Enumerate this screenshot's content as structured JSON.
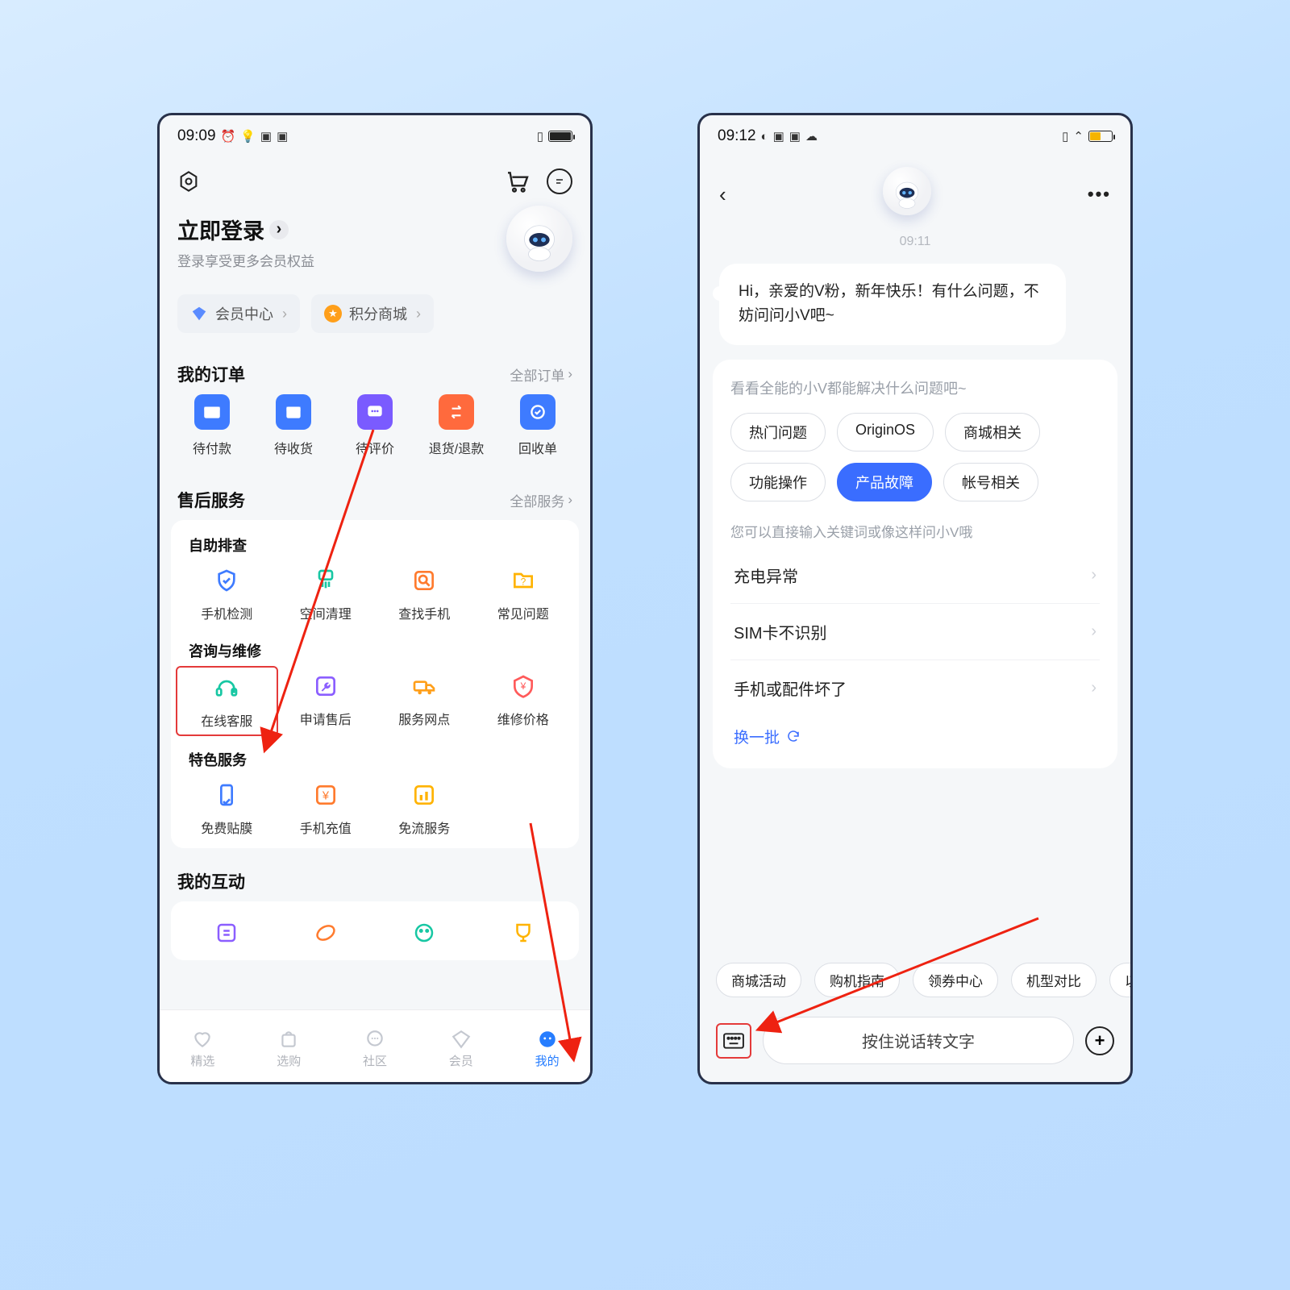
{
  "phone1": {
    "status": {
      "time": "09:09"
    },
    "login": {
      "title": "立即登录",
      "subtitle": "登录享受更多会员权益"
    },
    "chips": [
      {
        "label": "会员中心",
        "icon": "diamond",
        "color": "#5a8bff"
      },
      {
        "label": "积分商城",
        "icon": "star",
        "color": "#ff9f1a"
      }
    ],
    "orders": {
      "title": "我的订单",
      "link": "全部订单",
      "items": [
        {
          "label": "待付款",
          "icon": "wallet",
          "bg": "#3e7bff"
        },
        {
          "label": "待收货",
          "icon": "box",
          "bg": "#3e7bff"
        },
        {
          "label": "待评价",
          "icon": "chat",
          "bg": "#7a5bff"
        },
        {
          "label": "退货/退款",
          "icon": "swap",
          "bg": "#ff6a3d"
        },
        {
          "label": "回收单",
          "icon": "recycle",
          "bg": "#3e7bff"
        }
      ]
    },
    "aftersale": {
      "title": "售后服务",
      "link": "全部服务",
      "groups": [
        {
          "title": "自助排查",
          "items": [
            {
              "label": "手机检测",
              "icon": "shield",
              "color": "#3e7bff"
            },
            {
              "label": "空间清理",
              "icon": "brush",
              "color": "#17c7a3"
            },
            {
              "label": "查找手机",
              "icon": "search",
              "color": "#ff7b2e"
            },
            {
              "label": "常见问题",
              "icon": "folder",
              "color": "#ffb300"
            }
          ]
        },
        {
          "title": "咨询与维修",
          "items": [
            {
              "label": "在线客服",
              "icon": "headset",
              "color": "#17c7a3"
            },
            {
              "label": "申请售后",
              "icon": "wrench",
              "color": "#8b5eff"
            },
            {
              "label": "服务网点",
              "icon": "truck",
              "color": "#ff9f1a"
            },
            {
              "label": "维修价格",
              "icon": "tag",
              "color": "#ff5a5a"
            }
          ]
        },
        {
          "title": "特色服务",
          "items": [
            {
              "label": "免费贴膜",
              "icon": "phone",
              "color": "#3e7bff"
            },
            {
              "label": "手机充值",
              "icon": "yen",
              "color": "#ff7b2e"
            },
            {
              "label": "免流服务",
              "icon": "data",
              "color": "#ffb300"
            }
          ]
        }
      ]
    },
    "interact": {
      "title": "我的互动"
    },
    "tabs": [
      {
        "label": "精选",
        "icon": "heart"
      },
      {
        "label": "选购",
        "icon": "bag"
      },
      {
        "label": "社区",
        "icon": "bubble"
      },
      {
        "label": "会员",
        "icon": "gem"
      },
      {
        "label": "我的",
        "icon": "face",
        "active": true
      }
    ]
  },
  "phone2": {
    "status": {
      "time": "09:12"
    },
    "chat": {
      "timestamp": "09:11",
      "greeting": "Hi，亲爱的V粉，新年快乐！有什么问题，不妨问问小V吧~",
      "subtitle1": "看看全能的小V都能解决什么问题吧~",
      "categories": [
        {
          "label": "热门问题"
        },
        {
          "label": "OriginOS"
        },
        {
          "label": "商城相关"
        },
        {
          "label": "功能操作"
        },
        {
          "label": "产品故障",
          "active": true
        },
        {
          "label": "帐号相关"
        }
      ],
      "hint": "您可以直接输入关键词或像这样问小V哦",
      "list": [
        "充电异常",
        "SIM卡不识别",
        "手机或配件坏了"
      ],
      "refresh": "换一批"
    },
    "suggest": [
      "商城活动",
      "购机指南",
      "领券中心",
      "机型对比",
      "以"
    ],
    "input": {
      "placeholder": "按住说话转文字"
    }
  }
}
